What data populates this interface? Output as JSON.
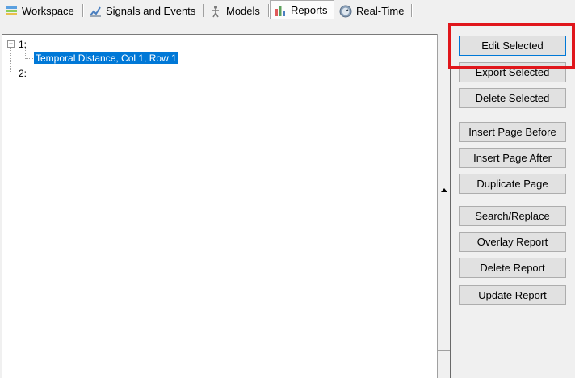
{
  "tabs": [
    {
      "label": "Workspace",
      "icon": "workspace-icon",
      "active": false
    },
    {
      "label": "Signals and Events",
      "icon": "signals-icon",
      "active": false
    },
    {
      "label": "Models",
      "icon": "models-icon",
      "active": false
    },
    {
      "label": "Reports",
      "icon": "reports-icon",
      "active": true
    },
    {
      "label": "Real-Time",
      "icon": "realtime-icon",
      "active": false
    }
  ],
  "tree": {
    "page1": "1:",
    "page1_item": "Temporal Distance, Col 1, Row 1",
    "page2": "2:",
    "expander": "−"
  },
  "buttons": {
    "edit_selected": "Edit Selected",
    "export_selected": "Export Selected",
    "delete_selected": "Delete Selected",
    "insert_page_before": "Insert Page Before",
    "insert_page_after": "Insert Page After",
    "duplicate_page": "Duplicate Page",
    "search_replace": "Search/Replace",
    "overlay_report": "Overlay Report",
    "delete_report": "Delete Report",
    "update_report": "Update Report"
  },
  "colors": {
    "selection": "#0078d7",
    "highlight_box": "#e0161b"
  }
}
